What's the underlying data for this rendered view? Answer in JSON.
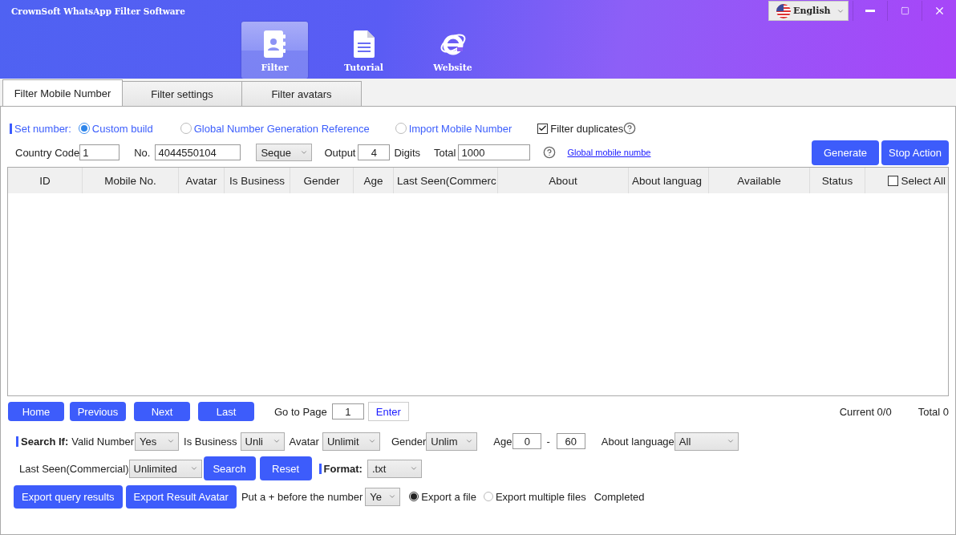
{
  "window": {
    "title": "CrownSoft WhatsApp Filter Software",
    "language": "English"
  },
  "nav": [
    {
      "label": "Filter",
      "kind": "book",
      "selected": true
    },
    {
      "label": "Tutorial",
      "kind": "doc",
      "selected": false
    },
    {
      "label": "Website",
      "kind": "globe",
      "selected": false
    }
  ],
  "tabs": [
    {
      "label": "Filter Mobile Number",
      "selected": true
    },
    {
      "label": "Filter settings",
      "selected": false
    },
    {
      "label": "Filter avatars",
      "selected": false
    }
  ],
  "set_number": {
    "label": "Set number:",
    "options": [
      {
        "label": "Custom build",
        "selected": true
      },
      {
        "label": "Global Number Generation Reference",
        "selected": false
      },
      {
        "label": "Import Mobile Number",
        "selected": false
      }
    ],
    "filter_duplicates": {
      "label": "Filter duplicates",
      "checked": true
    }
  },
  "generator": {
    "country_code_label": "Country Code",
    "country_code": "1",
    "no_label": "No.",
    "no": "4044550104",
    "mode": "Seque",
    "output_label": "Output",
    "output": "4",
    "digits_label": "Digits",
    "total_label": "Total",
    "total": "1000",
    "link": "Global mobile numbe",
    "buttons": [
      "Generate",
      "Stop Action"
    ]
  },
  "table": {
    "columns": [
      "ID",
      "Mobile No.",
      "Avatar",
      "Is Business",
      "Gender",
      "Age",
      "Last Seen(Commerc",
      "About",
      "About languag",
      "Available",
      "Status"
    ],
    "select_all": {
      "label": "Select All",
      "checked": false
    }
  },
  "pager": {
    "buttons": [
      "Home",
      "Previous",
      "Next",
      "Last"
    ],
    "goto_label": "Go to Page",
    "page": "1",
    "enter": "Enter",
    "current": "Current 0/0",
    "total": "Total 0"
  },
  "search": {
    "label": "Search If:",
    "filters": [
      {
        "kind": "select",
        "label": "Valid Number",
        "value": "Yes"
      },
      {
        "kind": "select",
        "label": "Is Business",
        "value": "Unli"
      },
      {
        "kind": "select",
        "label": "Avatar",
        "value": "Unlimit"
      },
      {
        "kind": "select",
        "label": "Gender",
        "value": "Unlim"
      },
      {
        "kind": "range",
        "label": "Age",
        "from": "0",
        "separator": "-",
        "to": "60"
      },
      {
        "kind": "select",
        "label": "About language",
        "value": "All"
      }
    ]
  },
  "search2": {
    "last_seen_label": "Last Seen(Commercial)",
    "last_seen": "Unlimited",
    "buttons": [
      "Search",
      "Reset"
    ],
    "format_label": "Format:",
    "format": ".txt"
  },
  "export": {
    "buttons": [
      "Export query results",
      "Export Result Avatar"
    ],
    "plus_label": "Put a + before the number",
    "plus_value": "Ye",
    "modes": [
      {
        "label": "Export a file",
        "selected": true
      },
      {
        "label": "Export multiple files",
        "selected": false
      }
    ],
    "status": "Completed"
  }
}
